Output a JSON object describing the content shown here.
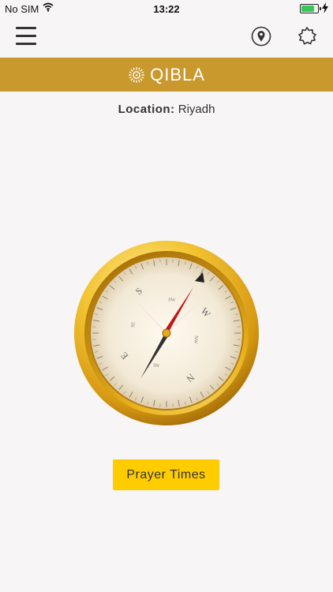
{
  "status_bar": {
    "carrier": "No SIM",
    "time": "13:22"
  },
  "header": {
    "title": "QIBLA",
    "icons": [
      "menu-icon",
      "location-pin-icon",
      "gear-icon",
      "sun-icon"
    ]
  },
  "location": {
    "label": "Location:",
    "value": "Riyadh"
  },
  "compass": {
    "cardinals": [
      "S",
      "W",
      "N",
      "E"
    ],
    "intercardinals": [
      "SW",
      "NW",
      "NE",
      "SE"
    ]
  },
  "actions": {
    "prayer_times_label": "Prayer Times"
  },
  "colors": {
    "accent": "#c9992d",
    "button": "#ffcc00",
    "needle": "#c0181c"
  }
}
